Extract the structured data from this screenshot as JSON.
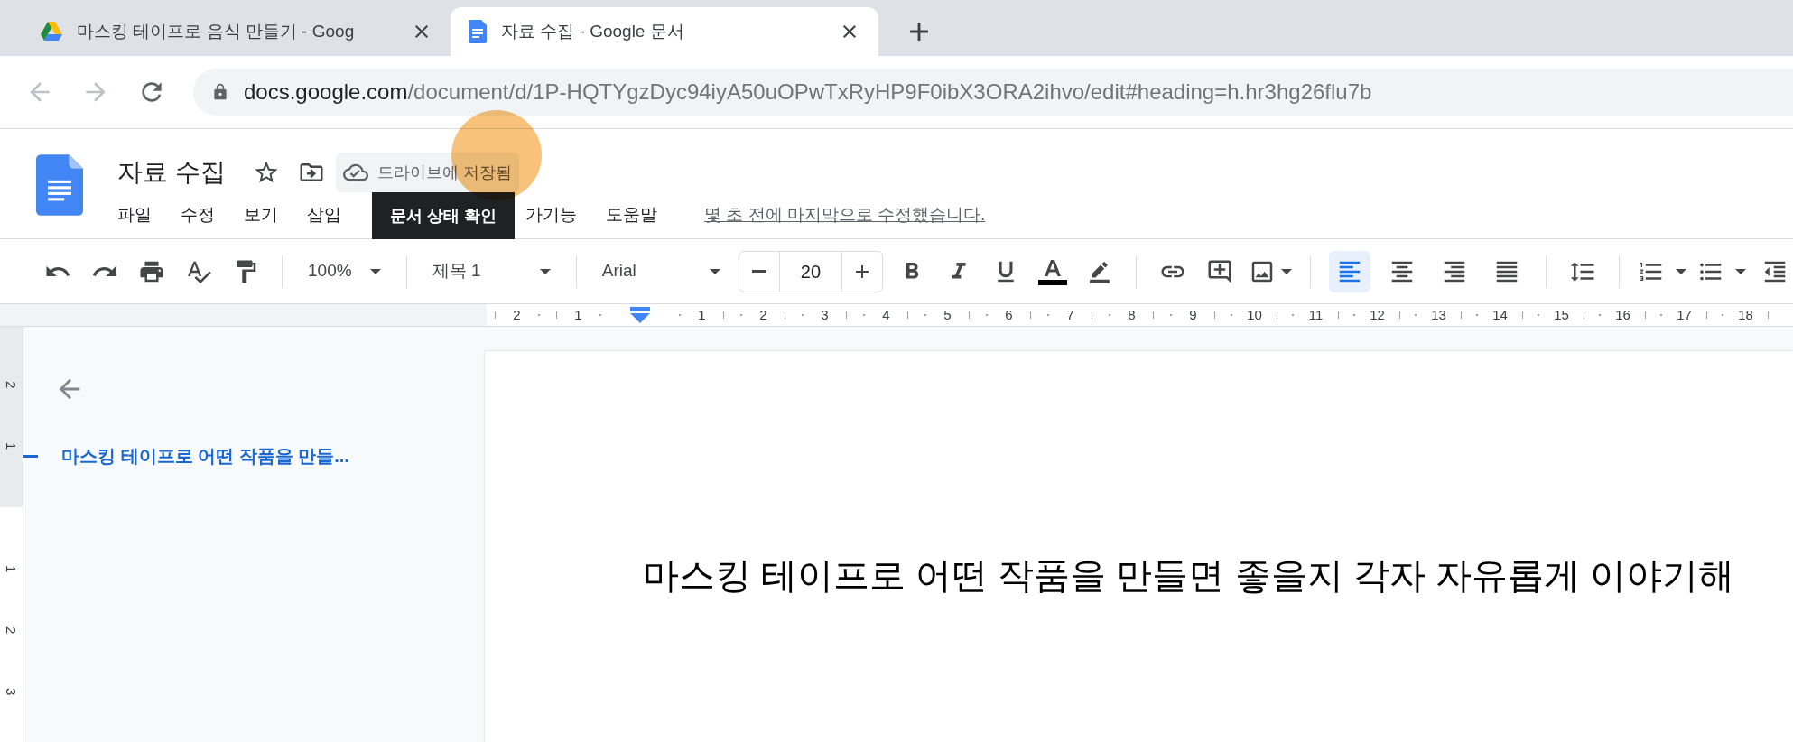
{
  "browser": {
    "tabs": [
      {
        "kind": "drive",
        "title": "마스킹 테이프로 음식 만들기 - Goog",
        "selected": false
      },
      {
        "kind": "docs",
        "title": "자료 수집 - Google 문서",
        "selected": true
      }
    ],
    "navigation": [
      {
        "kind": "back",
        "disabled": true
      },
      {
        "kind": "forward",
        "disabled": true
      },
      {
        "kind": "reload",
        "disabled": false
      }
    ],
    "url_host": "docs.google.com",
    "url_path": "/document/d/1P-HQTYgzDyc94iyA50uOPwTxRyHP9F0ibX3ORA2ihvo/edit#heading=h.hr3hg26flu7b"
  },
  "document": {
    "title": "자료 수집",
    "save_status": "드라이브에 저장됨",
    "tooltip": "문서 상태 확인",
    "menu_before_tooltip": [
      "파일",
      "수정",
      "보기",
      "삽입"
    ],
    "menu_after_tooltip": [
      "가기능",
      "도움말"
    ],
    "last_edit": "몇 초 전에 마지막으로 수정했습니다."
  },
  "toolbar": {
    "zoom": "100%",
    "style": "제목 1",
    "font": "Arial",
    "font_size": "20",
    "alignments": [
      {
        "kind": "left",
        "selected": true
      },
      {
        "kind": "center",
        "selected": false
      },
      {
        "kind": "right",
        "selected": false
      },
      {
        "kind": "justify",
        "selected": false
      }
    ]
  },
  "ruler": {
    "before": [
      "2",
      "1"
    ],
    "after": [
      "1",
      "2",
      "3",
      "4",
      "5",
      "6",
      "7",
      "8",
      "9",
      "10",
      "11",
      "12",
      "13",
      "14",
      "15",
      "16",
      "17",
      "18"
    ],
    "vertical_before": [
      "2",
      "1"
    ],
    "vertical_after": [
      "1",
      "2",
      "3"
    ]
  },
  "outline": {
    "headings": [
      {
        "text": "마스킹 테이프로 어떤 작품을 만들...",
        "selected": true
      }
    ]
  },
  "page": {
    "heading": "마스킹 테이프로 어떤 작품을 만들면 좋을지 각자 자유롭게 이야기해"
  }
}
